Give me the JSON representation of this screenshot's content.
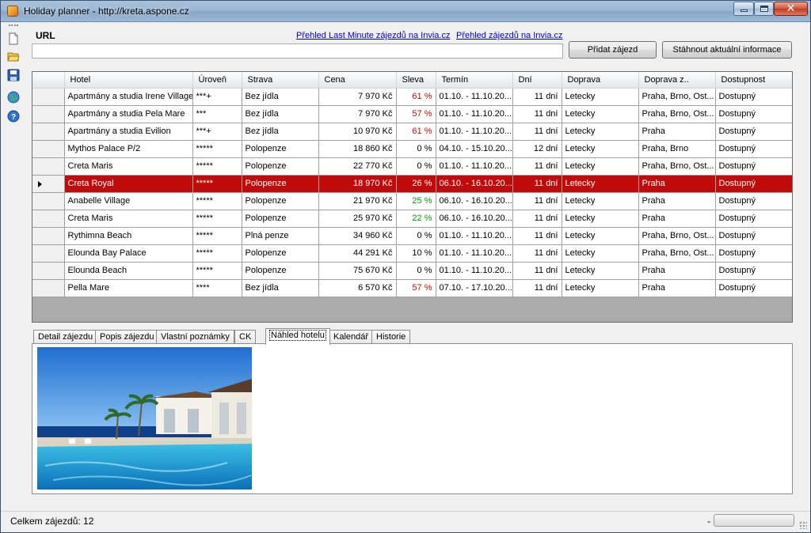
{
  "window": {
    "title": "Holiday planner - http://kreta.aspone.cz"
  },
  "toolbar": {
    "icons": [
      "new-file-icon",
      "open-folder-icon",
      "save-icon",
      "web-icon",
      "help-icon"
    ]
  },
  "url_section": {
    "label": "URL",
    "input_value": "",
    "link_last_minute": "Přehled Last Minute zájezdů na Invia.cz",
    "link_overview": "Přehled zájezdů na Invia.cz",
    "add_button": "Přidat zájezd",
    "download_button": "Stáhnout aktuální informace"
  },
  "grid": {
    "columns": [
      "Hotel",
      "Úroveň",
      "Strava",
      "Cena",
      "Sleva",
      "Termín",
      "Dní",
      "Doprava",
      "Doprava z..",
      "Dostupnost"
    ],
    "selected_index": 5,
    "rows": [
      {
        "hotel": "Apartmány a studia Irene Village",
        "level": "***+",
        "board": "Bez jídla",
        "price": "7 970 Kč",
        "discount": "61 %",
        "discount_color": "red",
        "term": "01.10. - 11.10.20...",
        "days": "11 dní",
        "transport": "Letecky",
        "from": "Praha, Brno, Ost...",
        "availability": "Dostupný"
      },
      {
        "hotel": "Apartmány a studia Pela Mare",
        "level": "***",
        "board": "Bez jídla",
        "price": "7 970 Kč",
        "discount": "57 %",
        "discount_color": "red",
        "term": "01.10. - 11.10.20...",
        "days": "11 dní",
        "transport": "Letecky",
        "from": "Praha, Brno, Ost...",
        "availability": "Dostupný"
      },
      {
        "hotel": "Apartmány a studia Evilion",
        "level": "***+",
        "board": "Bez jídla",
        "price": "10 970 Kč",
        "discount": "61 %",
        "discount_color": "red",
        "term": "01.10. - 11.10.20...",
        "days": "11 dní",
        "transport": "Letecky",
        "from": "Praha",
        "availability": "Dostupný"
      },
      {
        "hotel": "Mythos Palace P/2",
        "level": "*****",
        "board": "Polopenze",
        "price": "18 860 Kč",
        "discount": "0 %",
        "discount_color": "black",
        "term": "04.10. - 15.10.20...",
        "days": "12 dní",
        "transport": "Letecky",
        "from": "Praha, Brno",
        "availability": "Dostupný"
      },
      {
        "hotel": "Creta Maris",
        "level": "*****",
        "board": "Polopenze",
        "price": "22 770 Kč",
        "discount": "0 %",
        "discount_color": "black",
        "term": "01.10. - 11.10.20...",
        "days": "11 dní",
        "transport": "Letecky",
        "from": "Praha, Brno, Ost...",
        "availability": "Dostupný"
      },
      {
        "hotel": "Creta Royal",
        "level": "*****",
        "board": "Polopenze",
        "price": "18 970 Kč",
        "discount": "26 %",
        "discount_color": "black",
        "term": "06.10. - 16.10.20...",
        "days": "11 dní",
        "transport": "Letecky",
        "from": "Praha",
        "availability": "Dostupný"
      },
      {
        "hotel": "Anabelle Village",
        "level": "*****",
        "board": "Polopenze",
        "price": "21 970 Kč",
        "discount": "25 %",
        "discount_color": "green",
        "term": "06.10. - 16.10.20...",
        "days": "11 dní",
        "transport": "Letecky",
        "from": "Praha",
        "availability": "Dostupný"
      },
      {
        "hotel": "Creta Maris",
        "level": "*****",
        "board": "Polopenze",
        "price": "25 970 Kč",
        "discount": "22 %",
        "discount_color": "green",
        "term": "06.10. - 16.10.20...",
        "days": "11 dní",
        "transport": "Letecky",
        "from": "Praha",
        "availability": "Dostupný"
      },
      {
        "hotel": "Rythimna Beach",
        "level": "*****",
        "board": "Plná penze",
        "price": "34 960 Kč",
        "discount": "0 %",
        "discount_color": "black",
        "term": "01.10. - 11.10.20...",
        "days": "11 dní",
        "transport": "Letecky",
        "from": "Praha, Brno, Ost...",
        "availability": "Dostupný"
      },
      {
        "hotel": "Elounda Bay Palace",
        "level": "*****",
        "board": "Polopenze",
        "price": "44 291 Kč",
        "discount": "10 %",
        "discount_color": "black",
        "term": "01.10. - 11.10.20...",
        "days": "11 dní",
        "transport": "Letecky",
        "from": "Praha, Brno, Ost...",
        "availability": "Dostupný"
      },
      {
        "hotel": "Elounda Beach",
        "level": "*****",
        "board": "Polopenze",
        "price": "75 670 Kč",
        "discount": "0 %",
        "discount_color": "black",
        "term": "01.10. - 11.10.20...",
        "days": "11 dní",
        "transport": "Letecky",
        "from": "Praha",
        "availability": "Dostupný"
      },
      {
        "hotel": "Pella Mare",
        "level": "****",
        "board": "Bez jídla",
        "price": "6 570 Kč",
        "discount": "57 %",
        "discount_color": "red",
        "term": "07.10. - 17.10.20...",
        "days": "11 dní",
        "transport": "Letecky",
        "from": "Praha",
        "availability": "Dostupný"
      }
    ]
  },
  "tabs": {
    "active_index": 4,
    "items": [
      "Detail zájezdu",
      "Popis zájezdu",
      "Vlastní poznámky",
      "CK",
      "Náhled hotelu",
      "Kalendář",
      "Historie"
    ]
  },
  "status": {
    "count_text": "Celkem zájezdů: 12",
    "dash": "-"
  },
  "colors": {
    "selected_row": "#c10b0b",
    "discount_red": "#e00000",
    "discount_green": "#00a000",
    "link": "#0000d8"
  }
}
